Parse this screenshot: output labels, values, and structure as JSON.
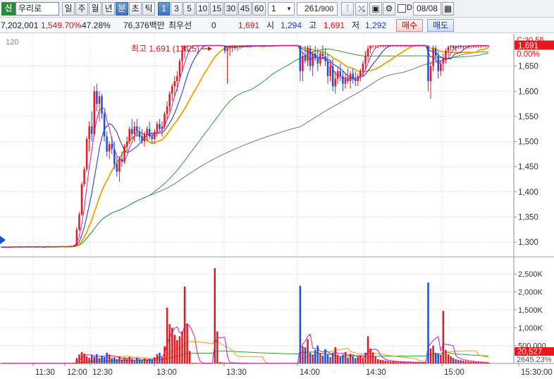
{
  "toolbar": {
    "badge": "신",
    "stock_name": "우리로",
    "period_buttons": [
      "일",
      "주",
      "월",
      "년",
      "분",
      "초",
      "틱"
    ],
    "active_period": "분",
    "interval_buttons": [
      "1",
      "3",
      "5",
      "10",
      "15",
      "30",
      "45",
      "60"
    ],
    "active_interval": "1",
    "interval_select_value": "1",
    "count_value": "261",
    "count_total": "/900",
    "d_label": "D",
    "date_value": "08/08",
    "icons": [
      "candle-type-icon",
      "crosshair-icon",
      "save-icon",
      "settings-icon",
      "calendar-icon"
    ]
  },
  "infobar": {
    "volume": "7,202,001",
    "volume_ratio": "1,549.70%",
    "turnover_pct": "47.28%",
    "amount": "76,376백만",
    "best_quote_label": "최우선",
    "best_quote_value": "0",
    "current_price": "1,691",
    "open_label": "시",
    "open_value": "1,294",
    "high_label": "고",
    "high_value": "1,691",
    "low_label": "저",
    "low_value": "1,292",
    "buy_label": "매수",
    "sell_label": "매도"
  },
  "chart_data": {
    "type": "candlestick",
    "price_axis": {
      "ticks": [
        1300,
        1350,
        1400,
        1450,
        1500,
        1550,
        1600,
        1650
      ],
      "ylim": [
        1272,
        1700
      ]
    },
    "time_axis": {
      "ticks": [
        "11:30",
        "12:00",
        "12:30",
        "13:00",
        "13:30",
        "14:00",
        "14:30",
        "15:00",
        "15:30:00"
      ]
    },
    "top_left_label": "120",
    "high_annotation": "최고 1,691 (13:25)",
    "current_price_label": "1,691",
    "change_label": "0.00%",
    "prev_label": "C:30.58",
    "volume_axis": {
      "ticks": [
        "500,000",
        "1,000K",
        "1,500K",
        "2,000K",
        "2,500K"
      ],
      "ylim": [
        0,
        2800000
      ]
    },
    "volume_current_label": "20,527",
    "volume_ratio_label": "2645.23%",
    "colors": {
      "up": "#e8161d",
      "down": "#1f4fd8",
      "ma5": "#c21bd1",
      "ma10": "#1b2fb5",
      "ma20": "#f0a000",
      "ma60": "#2a9d3a",
      "ma120": "#707070"
    },
    "candles": [
      [
        1291,
        1291,
        1290,
        1290
      ],
      [
        1291,
        1291,
        1289,
        1290
      ],
      [
        1290,
        1291,
        1289,
        1290
      ],
      [
        1290,
        1290,
        1289,
        1290
      ],
      [
        1290,
        1292,
        1289,
        1291
      ],
      [
        1291,
        1291,
        1290,
        1291
      ],
      [
        1291,
        1291,
        1290,
        1290
      ],
      [
        1290,
        1291,
        1289,
        1291
      ],
      [
        1291,
        1292,
        1289,
        1290
      ],
      [
        1290,
        1291,
        1290,
        1291
      ],
      [
        1291,
        1292,
        1290,
        1291
      ],
      [
        1291,
        1291,
        1289,
        1290
      ],
      [
        1290,
        1292,
        1290,
        1291
      ],
      [
        1291,
        1292,
        1290,
        1290
      ],
      [
        1290,
        1291,
        1289,
        1291
      ],
      [
        1291,
        1292,
        1290,
        1291
      ],
      [
        1291,
        1292,
        1290,
        1290
      ],
      [
        1290,
        1291,
        1289,
        1290
      ],
      [
        1290,
        1292,
        1290,
        1292
      ],
      [
        1292,
        1292,
        1290,
        1291
      ],
      [
        1291,
        1292,
        1290,
        1291
      ],
      [
        1291,
        1292,
        1290,
        1291
      ],
      [
        1291,
        1291,
        1290,
        1290
      ],
      [
        1290,
        1292,
        1290,
        1292
      ],
      [
        1292,
        1292,
        1290,
        1291
      ],
      [
        1291,
        1292,
        1291,
        1291
      ],
      [
        1291,
        1292,
        1290,
        1291
      ],
      [
        1291,
        1292,
        1290,
        1292
      ],
      [
        1292,
        1293,
        1291,
        1292
      ],
      [
        1292,
        1294,
        1292,
        1294
      ],
      [
        1294,
        1330,
        1293,
        1325
      ],
      [
        1325,
        1360,
        1322,
        1355
      ],
      [
        1355,
        1420,
        1352,
        1415
      ],
      [
        1415,
        1450,
        1410,
        1445
      ],
      [
        1445,
        1510,
        1440,
        1505
      ],
      [
        1505,
        1540,
        1480,
        1530
      ],
      [
        1530,
        1560,
        1500,
        1515
      ],
      [
        1515,
        1610,
        1510,
        1600
      ],
      [
        1600,
        1615,
        1560,
        1575
      ],
      [
        1575,
        1600,
        1540,
        1590
      ],
      [
        1590,
        1595,
        1545,
        1555
      ],
      [
        1555,
        1560,
        1500,
        1510
      ],
      [
        1510,
        1520,
        1470,
        1480
      ],
      [
        1480,
        1500,
        1465,
        1495
      ],
      [
        1495,
        1510,
        1475,
        1485
      ],
      [
        1485,
        1500,
        1445,
        1455
      ],
      [
        1455,
        1470,
        1430,
        1440
      ],
      [
        1440,
        1470,
        1420,
        1465
      ],
      [
        1465,
        1480,
        1450,
        1460
      ],
      [
        1460,
        1495,
        1455,
        1490
      ],
      [
        1490,
        1510,
        1480,
        1500
      ],
      [
        1500,
        1530,
        1495,
        1525
      ],
      [
        1525,
        1545,
        1505,
        1515
      ],
      [
        1515,
        1540,
        1500,
        1530
      ],
      [
        1530,
        1545,
        1510,
        1520
      ],
      [
        1520,
        1530,
        1500,
        1510
      ],
      [
        1510,
        1525,
        1495,
        1500
      ],
      [
        1500,
        1520,
        1490,
        1515
      ],
      [
        1515,
        1530,
        1500,
        1525
      ],
      [
        1525,
        1540,
        1505,
        1510
      ],
      [
        1510,
        1520,
        1495,
        1505
      ],
      [
        1505,
        1525,
        1495,
        1520
      ],
      [
        1520,
        1540,
        1510,
        1535
      ],
      [
        1535,
        1545,
        1520,
        1525
      ],
      [
        1525,
        1540,
        1510,
        1530
      ],
      [
        1530,
        1560,
        1525,
        1555
      ],
      [
        1555,
        1580,
        1545,
        1570
      ],
      [
        1570,
        1600,
        1560,
        1595
      ],
      [
        1595,
        1615,
        1580,
        1610
      ],
      [
        1610,
        1630,
        1590,
        1620
      ],
      [
        1620,
        1640,
        1600,
        1630
      ],
      [
        1630,
        1665,
        1620,
        1660
      ],
      [
        1660,
        1690,
        1640,
        1680
      ],
      [
        1680,
        1691,
        1665,
        1691
      ],
      [
        1691,
        1691,
        1680,
        1691
      ],
      [
        1691,
        1691,
        1691,
        1691
      ],
      [
        1691,
        1691,
        1691,
        1691
      ],
      [
        1691,
        1691,
        1691,
        1691
      ],
      [
        1691,
        1691,
        1691,
        1691
      ],
      [
        1691,
        1691,
        1691,
        1691
      ],
      [
        1691,
        1691,
        1691,
        1691
      ],
      [
        1691,
        1691,
        1691,
        1691
      ],
      [
        1691,
        1691,
        1691,
        1691
      ],
      [
        1691,
        1691,
        1691,
        1691
      ],
      [
        1691,
        1691,
        1691,
        1691
      ],
      [
        1691,
        1691,
        1691,
        1691
      ],
      [
        1691,
        1691,
        1691,
        1691
      ],
      [
        1691,
        1691,
        1691,
        1691
      ],
      [
        1691,
        1691,
        1691,
        1691
      ],
      [
        1691,
        1691,
        1675,
        1680
      ],
      [
        1680,
        1691,
        1615,
        1685
      ],
      [
        1685,
        1691,
        1670,
        1688
      ],
      [
        1688,
        1691,
        1678,
        1691
      ],
      [
        1691,
        1691,
        1682,
        1688
      ],
      [
        1688,
        1691,
        1680,
        1690
      ],
      [
        1690,
        1691,
        1684,
        1691
      ],
      [
        1691,
        1691,
        1686,
        1691
      ],
      [
        1691,
        1691,
        1688,
        1691
      ],
      [
        1691,
        1691,
        1688,
        1690
      ],
      [
        1690,
        1691,
        1686,
        1691
      ],
      [
        1691,
        1691,
        1687,
        1690
      ],
      [
        1690,
        1691,
        1688,
        1691
      ],
      [
        1691,
        1691,
        1689,
        1691
      ],
      [
        1691,
        1691,
        1688,
        1690
      ],
      [
        1690,
        1691,
        1687,
        1691
      ],
      [
        1691,
        1691,
        1688,
        1691
      ],
      [
        1691,
        1691,
        1689,
        1690
      ],
      [
        1690,
        1691,
        1688,
        1691
      ],
      [
        1691,
        1691,
        1689,
        1691
      ],
      [
        1691,
        1691,
        1690,
        1691
      ],
      [
        1691,
        1691,
        1690,
        1691
      ],
      [
        1691,
        1691,
        1690,
        1691
      ],
      [
        1691,
        1691,
        1690,
        1691
      ],
      [
        1691,
        1691,
        1690,
        1691
      ],
      [
        1691,
        1691,
        1690,
        1691
      ],
      [
        1691,
        1691,
        1690,
        1691
      ],
      [
        1691,
        1691,
        1690,
        1691
      ],
      [
        1691,
        1691,
        1690,
        1691
      ],
      [
        1691,
        1691,
        1690,
        1691
      ],
      [
        1691,
        1691,
        1620,
        1640
      ],
      [
        1640,
        1680,
        1620,
        1670
      ],
      [
        1670,
        1690,
        1655,
        1660
      ],
      [
        1660,
        1691,
        1650,
        1685
      ],
      [
        1685,
        1691,
        1640,
        1650
      ],
      [
        1650,
        1680,
        1630,
        1675
      ],
      [
        1675,
        1690,
        1660,
        1665
      ],
      [
        1665,
        1685,
        1640,
        1655
      ],
      [
        1655,
        1680,
        1650,
        1675
      ],
      [
        1675,
        1691,
        1665,
        1670
      ],
      [
        1670,
        1685,
        1650,
        1660
      ],
      [
        1660,
        1675,
        1615,
        1630
      ],
      [
        1630,
        1660,
        1620,
        1650
      ],
      [
        1650,
        1665,
        1600,
        1610
      ],
      [
        1610,
        1640,
        1595,
        1625
      ],
      [
        1625,
        1650,
        1615,
        1640
      ],
      [
        1640,
        1655,
        1620,
        1630
      ],
      [
        1630,
        1640,
        1600,
        1615
      ],
      [
        1615,
        1635,
        1605,
        1625
      ],
      [
        1625,
        1645,
        1615,
        1620
      ],
      [
        1620,
        1640,
        1605,
        1635
      ],
      [
        1635,
        1645,
        1615,
        1625
      ],
      [
        1625,
        1640,
        1610,
        1620
      ],
      [
        1620,
        1635,
        1610,
        1630
      ],
      [
        1630,
        1645,
        1620,
        1640
      ],
      [
        1640,
        1660,
        1630,
        1655
      ],
      [
        1655,
        1680,
        1645,
        1670
      ],
      [
        1670,
        1691,
        1660,
        1685
      ],
      [
        1685,
        1691,
        1675,
        1691
      ],
      [
        1691,
        1691,
        1685,
        1691
      ],
      [
        1691,
        1691,
        1686,
        1691
      ],
      [
        1691,
        1691,
        1686,
        1691
      ],
      [
        1691,
        1691,
        1687,
        1691
      ],
      [
        1691,
        1691,
        1687,
        1691
      ],
      [
        1691,
        1691,
        1687,
        1691
      ],
      [
        1691,
        1691,
        1688,
        1691
      ],
      [
        1691,
        1691,
        1688,
        1691
      ],
      [
        1691,
        1691,
        1688,
        1691
      ],
      [
        1691,
        1691,
        1688,
        1691
      ],
      [
        1691,
        1691,
        1688,
        1691
      ],
      [
        1691,
        1691,
        1688,
        1691
      ],
      [
        1691,
        1691,
        1688,
        1691
      ],
      [
        1691,
        1691,
        1688,
        1691
      ],
      [
        1691,
        1691,
        1688,
        1691
      ],
      [
        1691,
        1691,
        1688,
        1691
      ],
      [
        1691,
        1691,
        1689,
        1691
      ],
      [
        1691,
        1691,
        1689,
        1691
      ],
      [
        1691,
        1691,
        1689,
        1691
      ],
      [
        1691,
        1691,
        1689,
        1691
      ],
      [
        1691,
        1691,
        1689,
        1691
      ],
      [
        1691,
        1691,
        1689,
        1691
      ],
      [
        1691,
        1691,
        1600,
        1620
      ],
      [
        1620,
        1660,
        1585,
        1650
      ],
      [
        1650,
        1691,
        1640,
        1685
      ],
      [
        1685,
        1691,
        1660,
        1670
      ],
      [
        1670,
        1680,
        1625,
        1640
      ],
      [
        1640,
        1660,
        1630,
        1655
      ],
      [
        1655,
        1675,
        1640,
        1665
      ],
      [
        1665,
        1685,
        1655,
        1680
      ],
      [
        1680,
        1691,
        1670,
        1688
      ],
      [
        1688,
        1691,
        1680,
        1691
      ],
      [
        1691,
        1691,
        1682,
        1686
      ],
      [
        1686,
        1691,
        1680,
        1690
      ],
      [
        1690,
        1691,
        1684,
        1691
      ],
      [
        1691,
        1691,
        1684,
        1688
      ],
      [
        1688,
        1691,
        1683,
        1690
      ],
      [
        1690,
        1691,
        1684,
        1691
      ],
      [
        1691,
        1691,
        1685,
        1691
      ],
      [
        1691,
        1691,
        1685,
        1691
      ],
      [
        1691,
        1691,
        1686,
        1691
      ],
      [
        1691,
        1691,
        1686,
        1691
      ],
      [
        1691,
        1691,
        1686,
        1691
      ],
      [
        1691,
        1691,
        1686,
        1691
      ],
      [
        1691,
        1691,
        1687,
        1691
      ],
      [
        1691,
        1691,
        1687,
        1691
      ],
      [
        1691,
        1691,
        1687,
        1691
      ]
    ],
    "volumes": [
      5000,
      4000,
      6000,
      3000,
      5000,
      4000,
      6000,
      5000,
      3000,
      4000,
      5000,
      4000,
      3000,
      5000,
      4000,
      6000,
      5000,
      4000,
      3000,
      5000,
      4000,
      6000,
      5000,
      4000,
      3000,
      5000,
      4000,
      6000,
      5000,
      20000,
      150000,
      250000,
      320000,
      280000,
      200000,
      160000,
      230000,
      190000,
      260000,
      150000,
      220000,
      180000,
      300000,
      250000,
      140000,
      160000,
      120000,
      200000,
      110000,
      170000,
      130000,
      180000,
      120000,
      90000,
      160000,
      110000,
      80000,
      140000,
      100000,
      130000,
      90000,
      170000,
      260000,
      300000,
      180000,
      480000,
      1560000,
      1100000,
      1000000,
      800000,
      650000,
      760000,
      900000,
      2150000,
      1100000,
      350000,
      20000,
      18000,
      15000,
      12000,
      10000,
      8000,
      9000,
      10000,
      7000,
      2660000,
      900000,
      40000,
      30000,
      25000,
      20000,
      18000,
      15000,
      12000,
      10000,
      9000,
      8000,
      7000,
      6000,
      5000,
      5000,
      4000,
      4000,
      3000,
      3000,
      3000,
      3000,
      3000,
      3000,
      3000,
      3000,
      3000,
      3000,
      3000,
      3000,
      3000,
      3000,
      3000,
      3000,
      2170000,
      480000,
      450000,
      680000,
      300000,
      250000,
      380000,
      500000,
      290000,
      220000,
      400000,
      250000,
      180000,
      300000,
      460000,
      240000,
      190000,
      250000,
      320000,
      160000,
      270000,
      200000,
      150000,
      180000,
      220000,
      160000,
      300000,
      760000,
      420000,
      310000,
      200000,
      120000,
      100000,
      90000,
      80000,
      70000,
      60000,
      60000,
      50000,
      50000,
      50000,
      40000,
      40000,
      40000,
      40000,
      30000,
      30000,
      30000,
      30000,
      30000,
      30000,
      2260000,
      420000,
      500000,
      300000,
      270000,
      240000,
      1470000,
      380000,
      260000,
      200000,
      150000,
      120000,
      100000,
      90000,
      80000,
      70000,
      60000,
      50000,
      50000,
      40000,
      40000,
      30000,
      30000,
      20000,
      20000
    ]
  }
}
